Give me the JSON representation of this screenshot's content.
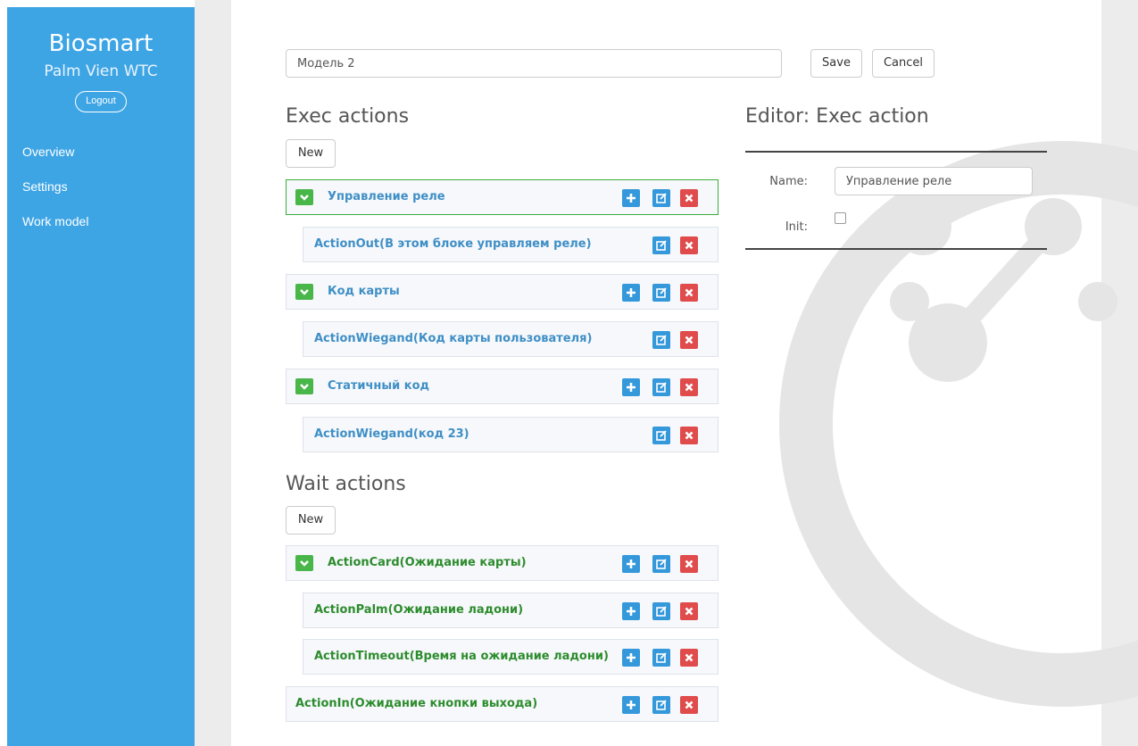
{
  "sidebar": {
    "brand": "Biosmart",
    "subtitle": "Palm Vien WTC",
    "logout_label": "Logout",
    "nav": [
      "Overview",
      "Settings",
      "Work model"
    ]
  },
  "model": {
    "name_value": "Модель 2",
    "save_label": "Save",
    "cancel_label": "Cancel"
  },
  "exec": {
    "title": "Exec actions",
    "new_label": "New",
    "items": [
      "Управление реле",
      "ActionOut(В этом блоке управляем реле)",
      "Код карты",
      "ActionWiegand(Код карты пользователя)",
      "Статичный код",
      "ActionWiegand(код 23)"
    ]
  },
  "wait": {
    "title": "Wait actions",
    "new_label": "New",
    "items": [
      "ActionCard(Ожидание карты)",
      "ActionPalm(Ожидание ладони)",
      "ActionTimeout(Время на ожидание ладони)",
      "ActionIn(Ожидание кнопки выхода)"
    ]
  },
  "editor": {
    "title": "Editor: Exec action",
    "name_label": "Name:",
    "name_value": "Управление реле",
    "init_label": "Init:",
    "init_checked": false
  },
  "colors": {
    "sidebar": "#3ea5e5",
    "exec_text": "#3f8fc6",
    "wait_text": "#2d8c2d",
    "chevron": "#49b649",
    "action_blue": "#3498db",
    "delete_red": "#e04b4b",
    "selected_border": "#3cae3c"
  },
  "icons": {
    "expand": "chevron-down-icon",
    "add": "plus-icon",
    "edit": "edit-icon",
    "delete": "close-icon"
  }
}
